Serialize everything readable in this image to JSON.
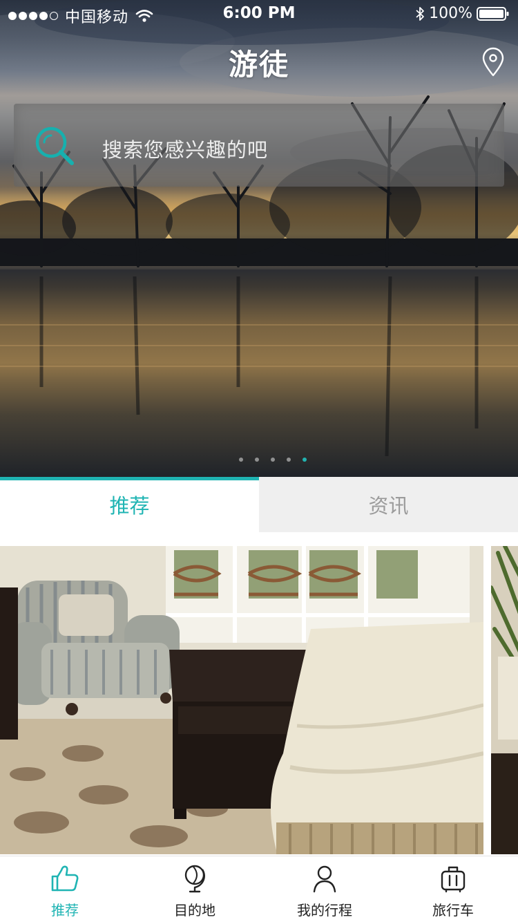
{
  "status_bar": {
    "carrier": "中国移动",
    "time": "6:00 PM",
    "battery": "100%",
    "icons": [
      "signal-dots",
      "wifi-icon",
      "bluetooth-icon",
      "battery-icon"
    ]
  },
  "header": {
    "title": "游徒",
    "location_icon": "location-pin-icon"
  },
  "search": {
    "placeholder": "搜索您感兴趣的吧",
    "icon": "search-icon"
  },
  "carousel": {
    "page_count": 5,
    "active_index": 4
  },
  "tabs": [
    {
      "label": "推荐",
      "active": true
    },
    {
      "label": "资讯",
      "active": false
    }
  ],
  "bottom_nav": [
    {
      "label": "推荐",
      "icon": "thumbs-up-icon",
      "active": true
    },
    {
      "label": "目的地",
      "icon": "globe-icon",
      "active": false
    },
    {
      "label": "我的行程",
      "icon": "person-icon",
      "active": false
    },
    {
      "label": "旅行车",
      "icon": "luggage-icon",
      "active": false
    }
  ],
  "colors": {
    "accent": "#1fb4b3",
    "tab_inactive_bg": "#efefef",
    "tab_inactive_text": "#9b9b9b",
    "nav_text": "#222222"
  }
}
